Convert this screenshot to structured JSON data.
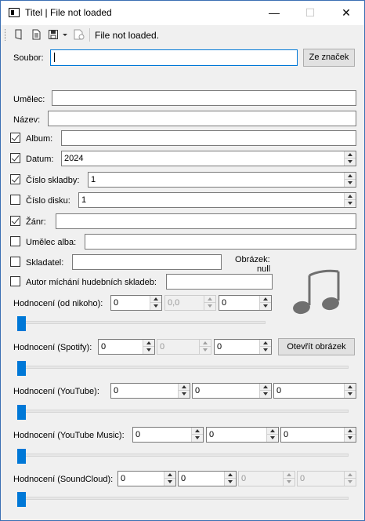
{
  "window": {
    "title": "Titel | File not loaded",
    "min_glyph": "—",
    "max_glyph": "☐",
    "close_glyph": "✕"
  },
  "toolbar": {
    "status": "File not loaded.",
    "icons": [
      "open-icon",
      "document-icon",
      "save-icon",
      "dropdown-arrow-icon",
      "settings-icon"
    ]
  },
  "file": {
    "label": "Soubor:",
    "value": "",
    "from_tags_button": "Ze značek"
  },
  "fields": {
    "artist": {
      "label": "Umělec:",
      "value": ""
    },
    "title": {
      "label": "Název:",
      "value": ""
    },
    "album": {
      "label": "Album:",
      "checked": true,
      "value": ""
    },
    "date": {
      "label": "Datum:",
      "checked": true,
      "value": "2024"
    },
    "track": {
      "label": "Číslo skladby:",
      "checked": true,
      "value": "1"
    },
    "disc": {
      "label": "Číslo disku:",
      "checked": false,
      "value": "1"
    },
    "genre": {
      "label": "Žánr:",
      "checked": true,
      "value": ""
    },
    "album_artist": {
      "label": "Umělec alba:",
      "checked": false,
      "value": ""
    },
    "composer": {
      "label": "Skladatel:",
      "checked": false,
      "value": ""
    },
    "remixer": {
      "label": "Autor míchání hudebních skladeb:",
      "checked": false,
      "value": ""
    }
  },
  "picture": {
    "label": "Obrázek:",
    "value": "null",
    "icon": "music-note-icon",
    "open_button": "Otevřít obrázek"
  },
  "ratings": {
    "nikoho": {
      "label": "Hodnocení (od nikoho):",
      "values": [
        "0",
        "0,0",
        "0"
      ],
      "disabled": [
        false,
        true,
        false
      ],
      "slider": 0
    },
    "spotify": {
      "label": "Hodnocení (Spotify):",
      "values": [
        "0",
        "0",
        "0"
      ],
      "disabled": [
        false,
        true,
        false
      ],
      "slider": 0
    },
    "youtube": {
      "label": "Hodnocení (YouTube):",
      "values": [
        "0",
        "0",
        "0"
      ],
      "disabled": [
        false,
        false,
        false
      ],
      "slider": 0
    },
    "youtube_music": {
      "label": "Hodnocení (YouTube Music):",
      "values": [
        "0",
        "0",
        "0"
      ],
      "disabled": [
        false,
        false,
        false
      ],
      "slider": 0
    },
    "soundcloud": {
      "label": "Hodnocení (SoundCloud):",
      "values": [
        "0",
        "0",
        "0",
        "0"
      ],
      "disabled": [
        false,
        false,
        true,
        true
      ],
      "slider": 0
    }
  },
  "colors": {
    "accent": "#0078d7",
    "border": "#7a7a7a",
    "background": "#f0f0f0"
  }
}
